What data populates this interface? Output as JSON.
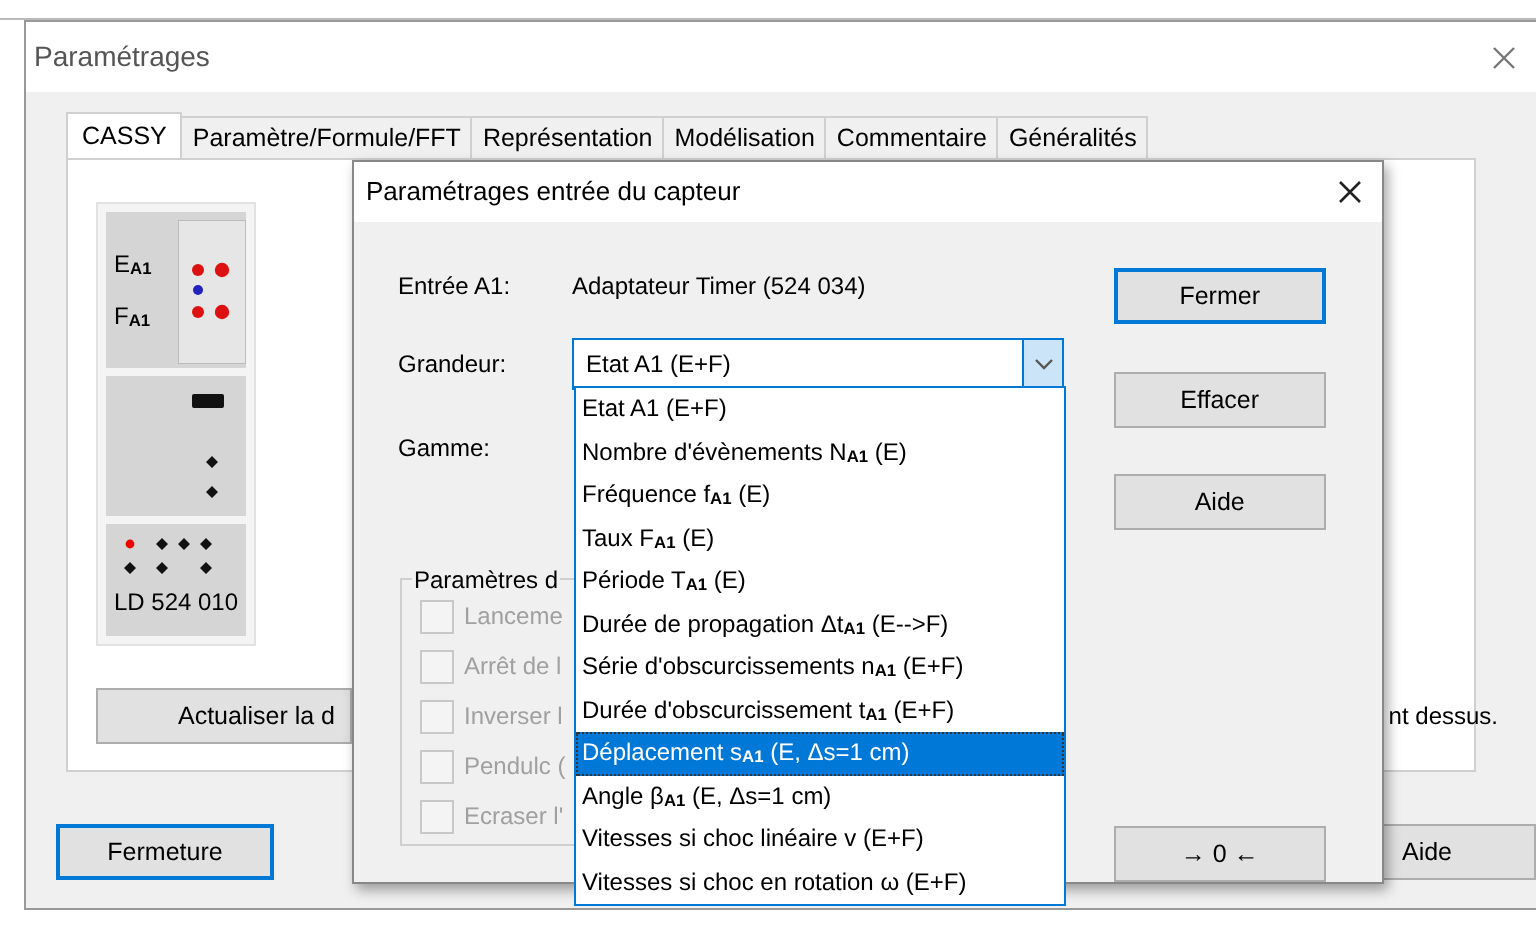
{
  "window": {
    "title": "Paramétrages"
  },
  "tabs": [
    {
      "label": "CASSY",
      "selected": true
    },
    {
      "label": "Paramètre/Formule/FFT",
      "selected": false
    },
    {
      "label": "Représentation",
      "selected": false
    },
    {
      "label": "Modélisation",
      "selected": false
    },
    {
      "label": "Commentaire",
      "selected": false
    },
    {
      "label": "Généralités",
      "selected": false
    }
  ],
  "device": {
    "input_labels": [
      "E$_{A1}$",
      "F$_{A1}$"
    ],
    "model": "LD 524 010"
  },
  "update_button": "Actualiser la d",
  "info_text": "nt dessus.",
  "footer_buttons": [
    {
      "label": "Fermeture",
      "focused": true
    },
    {
      "label": "Aide",
      "focused": false
    }
  ],
  "dialog": {
    "title": "Paramétrages entrée du capteur",
    "input_label": "Entrée A1:",
    "input_value": "Adaptateur Timer (524 034)",
    "quantity_label": "Grandeur:",
    "quantity_value": "Etat A1 (E+F)",
    "range_label": "Gamme:",
    "buttons": [
      {
        "label": "Fermer",
        "focused": true
      },
      {
        "label": "Effacer",
        "focused": false
      },
      {
        "label": "Aide",
        "focused": false
      }
    ],
    "zero_button": "→ 0 ←",
    "group_title": "Paramètres d",
    "options": [
      {
        "label": "Lanceme",
        "checked": false,
        "disabled": true
      },
      {
        "label": "Arrêt de l",
        "checked": false,
        "disabled": true
      },
      {
        "label": "Inverser l",
        "checked": false,
        "disabled": true
      },
      {
        "label": "Pendulc (",
        "checked": false,
        "disabled": true
      },
      {
        "label": "Ecraser l'",
        "checked": false,
        "disabled": true
      }
    ],
    "dropdown": [
      {
        "label": "Etat A1 (E+F)",
        "selected": false
      },
      {
        "label": "Nombre d'évènements N$_{A1}$ (E)",
        "selected": false
      },
      {
        "label": "Fréquence f$_{A1}$ (E)",
        "selected": false
      },
      {
        "label": "Taux F$_{A1}$ (E)",
        "selected": false
      },
      {
        "label": "Période T$_{A1}$ (E)",
        "selected": false
      },
      {
        "label": "Durée de propagation Δt$_{A1}$ (E-->F)",
        "selected": false
      },
      {
        "label": "Série d'obscurcissements n$_{A1}$ (E+F)",
        "selected": false
      },
      {
        "label": "Durée d'obscurcissement t$_{A1}$ (E+F)",
        "selected": false
      },
      {
        "label": "Déplacement s$_{A1}$ (E, Δs=1 cm)",
        "selected": true
      },
      {
        "label": "Angle β$_{A1}$ (E, Δs=1 cm)",
        "selected": false
      },
      {
        "label": "Vitesses si choc linéaire v (E+F)",
        "selected": false
      },
      {
        "label": "Vitesses si choc en rotation ω (E+F)",
        "selected": false
      }
    ]
  }
}
